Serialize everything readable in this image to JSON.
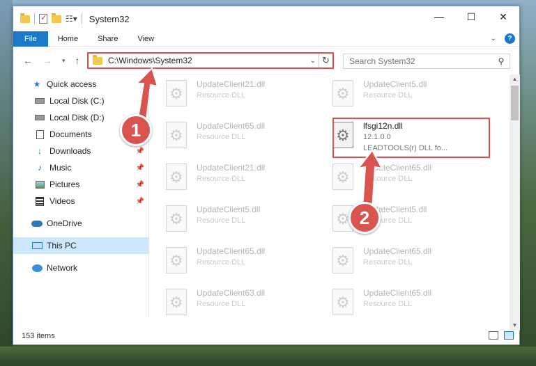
{
  "window": {
    "title": "System32",
    "controls": {
      "minimize": "—",
      "maximize": "☐",
      "close": "✕"
    }
  },
  "ribbon": {
    "tabs": [
      "File",
      "Home",
      "Share",
      "View"
    ],
    "help": "?"
  },
  "address": {
    "path": "C:\\Windows\\System32",
    "search_placeholder": "Search System32"
  },
  "nav": {
    "quick_access": "Quick access",
    "items": [
      {
        "label": "Local Disk (C:)",
        "icon": "drive-icon",
        "pinned": false
      },
      {
        "label": "Local Disk (D:)",
        "icon": "drive-icon",
        "pinned": false
      },
      {
        "label": "Documents",
        "icon": "documents-icon",
        "pinned": false
      },
      {
        "label": "Downloads",
        "icon": "downloads-icon",
        "pinned": true
      },
      {
        "label": "Music",
        "icon": "music-icon",
        "pinned": true
      },
      {
        "label": "Pictures",
        "icon": "pictures-icon",
        "pinned": true
      },
      {
        "label": "Videos",
        "icon": "videos-icon",
        "pinned": true
      }
    ],
    "onedrive": "OneDrive",
    "this_pc": "This PC",
    "network": "Network"
  },
  "files": [
    {
      "name": "UpdateClient21.dll",
      "type": "Resource DLL"
    },
    {
      "name": "UpdateClient5.dll",
      "type": "Resource DLL"
    },
    {
      "name": "UpdateClient65.dll",
      "type": "Resource DLL"
    },
    {
      "name": "lfsgi12n.dll",
      "version": "12.1.0.0",
      "desc": "LEADTOOLS(r) DLL fo..."
    },
    {
      "name": "UpdateClient21.dll",
      "type": "Resource DLL"
    },
    {
      "name": "UpdateClient65.dll",
      "type": "Resource DLL"
    },
    {
      "name": "UpdateClient5.dll",
      "type": "Resource DLL"
    },
    {
      "name": "UpdateClient5.dll",
      "type": "Resource DLL"
    },
    {
      "name": "UpdateClient65.dll",
      "type": "Resource DLL"
    },
    {
      "name": "UpdateClient65.dll",
      "type": "Resource DLL"
    },
    {
      "name": "UpdateClient63.dll",
      "type": "Resource DLL"
    },
    {
      "name": "UpdateClient65.dll",
      "type": "Resource DLL"
    }
  ],
  "status": {
    "count": "153 items"
  },
  "callouts": [
    "1",
    "2"
  ],
  "colors": {
    "accent": "#1979ca",
    "highlight": "#d9534f",
    "selected": "#cce8ff"
  }
}
